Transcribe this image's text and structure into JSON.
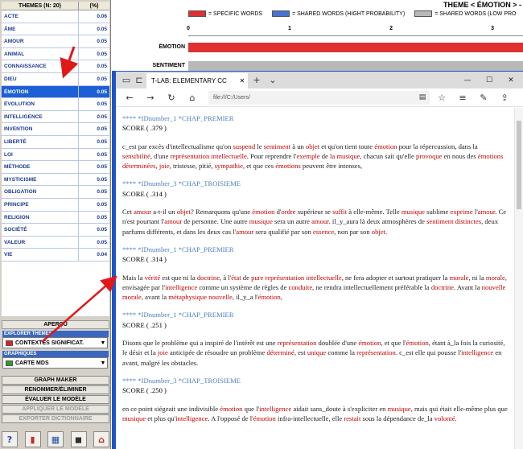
{
  "themes_table": {
    "header_name": "THEMES (N: 20)",
    "header_pct": "(%)",
    "rows": [
      {
        "name": "ACTE",
        "pct": "0.06"
      },
      {
        "name": "ÂME",
        "pct": "0.05"
      },
      {
        "name": "AMOUR",
        "pct": "0.05"
      },
      {
        "name": "ANIMAL",
        "pct": "0.05"
      },
      {
        "name": "CONNAISSANCE",
        "pct": "0.05"
      },
      {
        "name": "DIEU",
        "pct": "0.05"
      },
      {
        "name": "ÉMOTION",
        "pct": "0.05",
        "selected": true
      },
      {
        "name": "ÉVOLUTION",
        "pct": "0.05"
      },
      {
        "name": "INTELLIGENCE",
        "pct": "0.05"
      },
      {
        "name": "INVENTION",
        "pct": "0.05"
      },
      {
        "name": "LIBERTÉ",
        "pct": "0.05"
      },
      {
        "name": "LOI",
        "pct": "0.05"
      },
      {
        "name": "MÉTHODE",
        "pct": "0.05"
      },
      {
        "name": "MYSTICISME",
        "pct": "0.05"
      },
      {
        "name": "OBLIGATION",
        "pct": "0.05"
      },
      {
        "name": "PRINCIPE",
        "pct": "0.05"
      },
      {
        "name": "RELIGION",
        "pct": "0.05"
      },
      {
        "name": "SOCIÉTÉ",
        "pct": "0.05"
      },
      {
        "name": "VALEUR",
        "pct": "0.05"
      },
      {
        "name": "VIE",
        "pct": "0.04"
      }
    ]
  },
  "left_panel": {
    "apercu_label": "APERÇU",
    "explorer_label": "EXPLORER THEMES",
    "explorer_value": "CONTEXTES SIGNIFICAT.",
    "explorer_swatch": "#e02020",
    "graphiques_label": "GRAPHIQUES",
    "graphiques_value": "CARTE MDS",
    "graphiques_swatch": "#2e9a2e",
    "buttons": [
      {
        "label": "GRAPH MAKER",
        "enabled": true
      },
      {
        "label": "RENOMMER/ÉLIMINER",
        "enabled": true
      },
      {
        "label": "ÉVALUER LE MODÈLE",
        "enabled": true
      },
      {
        "label": "APPLIQUER LE MODÈLE",
        "enabled": false
      },
      {
        "label": "EXPORTER DICTIONNAIRE",
        "enabled": false
      }
    ],
    "bottom_icons": [
      {
        "name": "help-icon",
        "glyph": "?",
        "color": "#1c4fb0"
      },
      {
        "name": "chart-icon",
        "glyph": "▮",
        "color": "#c03030"
      },
      {
        "name": "grid-icon",
        "glyph": "▦",
        "color": "#2050a0"
      },
      {
        "name": "info-icon",
        "glyph": "◼",
        "color": "#303030"
      },
      {
        "name": "home-icon",
        "glyph": "⌂",
        "color": "#c02020"
      }
    ]
  },
  "chart": {
    "title": "THEME < ÉMOTION > -",
    "legend": [
      {
        "label": "= SPECIFIC WORDS",
        "color": "#e03030"
      },
      {
        "label": "= SHARED WORDS (HIGHT PROBABILITY)",
        "color": "#4a72d0"
      },
      {
        "label": "= SHARED WORDS (LOW PRO",
        "color": "#b8b8b8"
      }
    ],
    "ticks": [
      "0",
      "1",
      "2",
      "3"
    ],
    "categories": [
      "ÉMOTION",
      "SENTIMENT"
    ]
  },
  "chart_data": {
    "type": "bar",
    "title": "THEME < ÉMOTION > -",
    "categories": [
      "ÉMOTION",
      "SENTIMENT"
    ],
    "series": [
      {
        "name": "= SPECIFIC WORDS",
        "values": [
          3.3,
          0
        ]
      },
      {
        "name": "= SHARED WORDS (LOW PRO",
        "values": [
          0,
          3.3
        ]
      }
    ],
    "xlim": [
      0,
      3.3
    ],
    "orientation": "horizontal"
  },
  "browser": {
    "tab_title": "T-LAB: ELEMENTARY CC",
    "address": "file:///C:/Users/",
    "records": [
      {
        "tag": "**** *IDnumber_1 *CHAP_PREMIER",
        "score": "SCORE ( .379 )",
        "segments": [
          [
            "c_est par excès d'intellectualisme qu'on ",
            ""
          ],
          [
            "suspend",
            "hl"
          ],
          [
            " le ",
            ""
          ],
          [
            "sentiment",
            "hl"
          ],
          [
            " à un ",
            ""
          ],
          [
            "objet",
            "hl"
          ],
          [
            " et qu'on tient toute ",
            ""
          ],
          [
            "émotion",
            "hl"
          ],
          [
            " pour la répercussion, dans la ",
            ""
          ],
          [
            "sensibilité",
            "hl"
          ],
          [
            ", d'une ",
            ""
          ],
          [
            "représentation intellectuelle",
            "hl"
          ],
          [
            ". Pour reprendre l'",
            ""
          ],
          [
            "exemple",
            "hl"
          ],
          [
            " de ",
            ""
          ],
          [
            "la musique",
            "hl"
          ],
          [
            ", chacun sait qu'elle ",
            ""
          ],
          [
            "provoque",
            "hl"
          ],
          [
            " en nous des ",
            ""
          ],
          [
            "émotions déterminées",
            "hl"
          ],
          [
            ", ",
            ""
          ],
          [
            "joie",
            "hl"
          ],
          [
            ", tristesse, pitié, ",
            ""
          ],
          [
            "sympathie",
            "hl"
          ],
          [
            ", et que ces ",
            ""
          ],
          [
            "émotions",
            "hl"
          ],
          [
            " peuvent être intenses,",
            ""
          ]
        ]
      },
      {
        "tag": "**** *IDnumber_3 *CHAP_TROISIEME",
        "score": "SCORE ( .314 )",
        "segments": [
          [
            "Cet ",
            ""
          ],
          [
            "amour",
            "hl"
          ],
          [
            " a-t-il un ",
            ""
          ],
          [
            "objet",
            "hl"
          ],
          [
            "? Remarquons qu'une ",
            ""
          ],
          [
            "émotion",
            "hl"
          ],
          [
            " d'",
            ""
          ],
          [
            "ordre",
            "hl"
          ],
          [
            " supérieur se ",
            ""
          ],
          [
            "suffit",
            "hl"
          ],
          [
            " à elle-même. Telle ",
            ""
          ],
          [
            "musique",
            "hl"
          ],
          [
            " sublime ",
            ""
          ],
          [
            "exprime",
            "hl"
          ],
          [
            " l'",
            ""
          ],
          [
            "amour",
            "hl"
          ],
          [
            ". Ce n'est pourtant l'",
            ""
          ],
          [
            "amour",
            "hl"
          ],
          [
            " de personne. Une autre ",
            ""
          ],
          [
            "musique",
            "hl"
          ],
          [
            " sera un autre ",
            ""
          ],
          [
            "amour",
            "hl"
          ],
          [
            ". il_y_aura là deux atmosphères de ",
            ""
          ],
          [
            "sentiment distinctes",
            "hl"
          ],
          [
            ", deux parfums différents, et dans les deux cas l'",
            ""
          ],
          [
            "amour",
            "hl"
          ],
          [
            " sera qualifié par son ",
            ""
          ],
          [
            "essence",
            "hl"
          ],
          [
            ", non par son ",
            ""
          ],
          [
            "objet",
            "hl"
          ],
          [
            ".",
            ""
          ]
        ]
      },
      {
        "tag": "**** *IDnumber_1 *CHAP_PREMIER",
        "score": "SCORE ( .314 )",
        "segments": [
          [
            "Mais la ",
            ""
          ],
          [
            "vérité",
            "hl"
          ],
          [
            " est que ni la ",
            ""
          ],
          [
            "doctrine",
            "hl"
          ],
          [
            ", à l'",
            ""
          ],
          [
            "état",
            "hl"
          ],
          [
            " de ",
            ""
          ],
          [
            "pure représentation intellectuelle",
            "hl"
          ],
          [
            ", ne fera adopter et surtout pratiquer la ",
            ""
          ],
          [
            "morale",
            "hl"
          ],
          [
            ", ni la ",
            ""
          ],
          [
            "morale",
            "hl"
          ],
          [
            ", envisagée par l'",
            ""
          ],
          [
            "intelligence",
            "hl"
          ],
          [
            " comme un système de règles de ",
            ""
          ],
          [
            "conduite",
            "hl"
          ],
          [
            ", ne rendra intellectuellement préférable la ",
            ""
          ],
          [
            "doctrine",
            "hl"
          ],
          [
            ". Avant la ",
            ""
          ],
          [
            "nouvelle morale",
            "hl"
          ],
          [
            ", avant la ",
            ""
          ],
          [
            "métaphysique nouvelle",
            "hl"
          ],
          [
            ", il_y_a l'",
            ""
          ],
          [
            "émotion",
            "hl"
          ],
          [
            ",",
            ""
          ]
        ]
      },
      {
        "tag": "**** *IDnumber_1 *CHAP_PREMIER",
        "score": "SCORE ( .251 )",
        "segments": [
          [
            "Disons que le problème qui a inspiré de l'intérêt est une ",
            ""
          ],
          [
            "représentation",
            "hl"
          ],
          [
            " doublée d'une ",
            ""
          ],
          [
            "émotion",
            "hl"
          ],
          [
            ", et que l'",
            ""
          ],
          [
            "émotion",
            "hl"
          ],
          [
            ", étant à_la fois la curiosité, le désir et la ",
            ""
          ],
          [
            "joie",
            "hl"
          ],
          [
            " anticipée de résoudre un problème ",
            ""
          ],
          [
            "déterminé",
            "hl"
          ],
          [
            ", est ",
            ""
          ],
          [
            "unique",
            "hl"
          ],
          [
            " comme la ",
            ""
          ],
          [
            "représentation",
            "hl"
          ],
          [
            ". c_est elle qui pousse l'",
            ""
          ],
          [
            "intelligence",
            "hl"
          ],
          [
            " en avant, malgré les obstacles.",
            ""
          ]
        ]
      },
      {
        "tag": "**** *IDnumber_3 *CHAP_TROISIEME",
        "score": "SCORE ( .250 )",
        "segments": [
          [
            "en ce point siégeait une indivisible ",
            ""
          ],
          [
            "émotion",
            "hl"
          ],
          [
            " que l'",
            ""
          ],
          [
            "intelligence",
            "hl"
          ],
          [
            " aidait sans_doute à s'expliciter en ",
            ""
          ],
          [
            "musique",
            "hl"
          ],
          [
            ", mais qui était elle-même plus que ",
            ""
          ],
          [
            "musique",
            "hl"
          ],
          [
            " et plus qu'",
            ""
          ],
          [
            "intelligence",
            "hl"
          ],
          [
            ". A l'opposé de l'",
            ""
          ],
          [
            "émotion",
            "hl"
          ],
          [
            " infra-intellectuelle, elle ",
            ""
          ],
          [
            "restait",
            "hl"
          ],
          [
            " sous la dépendance de_la ",
            ""
          ],
          [
            "volonté",
            "hl"
          ],
          [
            ".",
            ""
          ]
        ]
      }
    ]
  }
}
